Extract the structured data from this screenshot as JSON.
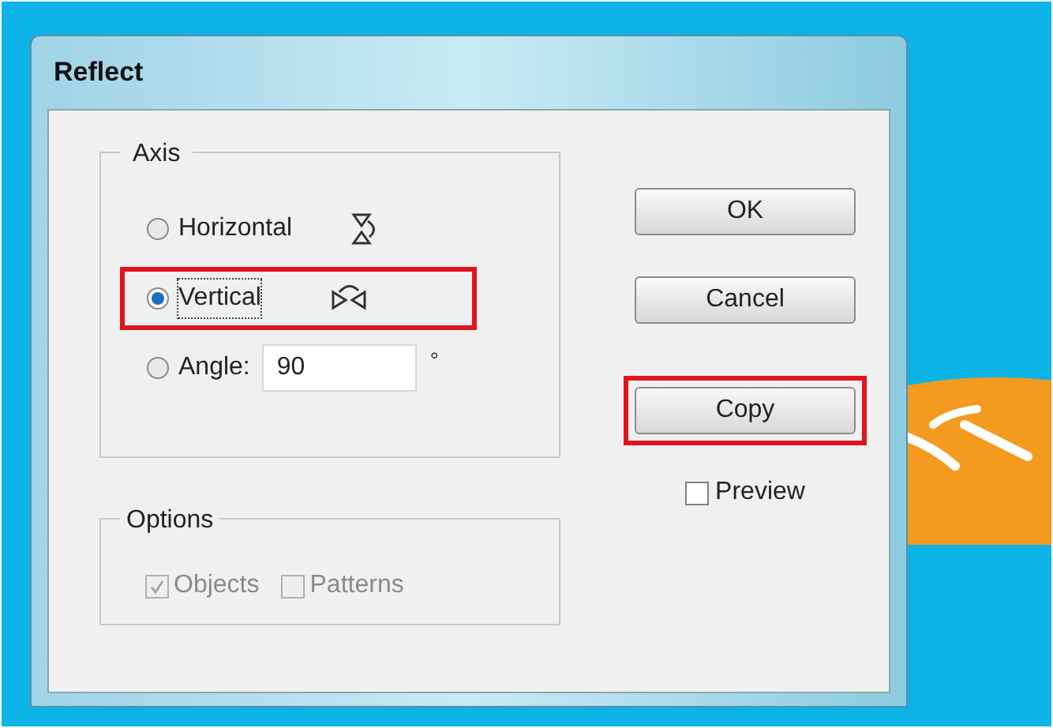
{
  "dialog": {
    "title": "Reflect"
  },
  "axis": {
    "label": "Axis",
    "options": [
      {
        "kind": "horizontal",
        "label": "Horizontal",
        "selected": false,
        "highlighted": false
      },
      {
        "kind": "vertical",
        "label": "Vertical",
        "selected": true,
        "highlighted": true
      },
      {
        "kind": "angle",
        "label": "Angle:",
        "selected": false,
        "highlighted": false,
        "value": "90",
        "unit": "°"
      }
    ]
  },
  "options": {
    "label": "Options",
    "items": [
      {
        "label": "Objects",
        "checked": true,
        "disabled": true
      },
      {
        "label": "Patterns",
        "checked": false,
        "disabled": true
      }
    ]
  },
  "buttons": [
    {
      "label": "OK",
      "highlighted": false
    },
    {
      "label": "Cancel",
      "highlighted": false
    },
    {
      "label": "Copy",
      "highlighted": true
    }
  ],
  "preview": {
    "label": "Preview",
    "checked": false
  }
}
